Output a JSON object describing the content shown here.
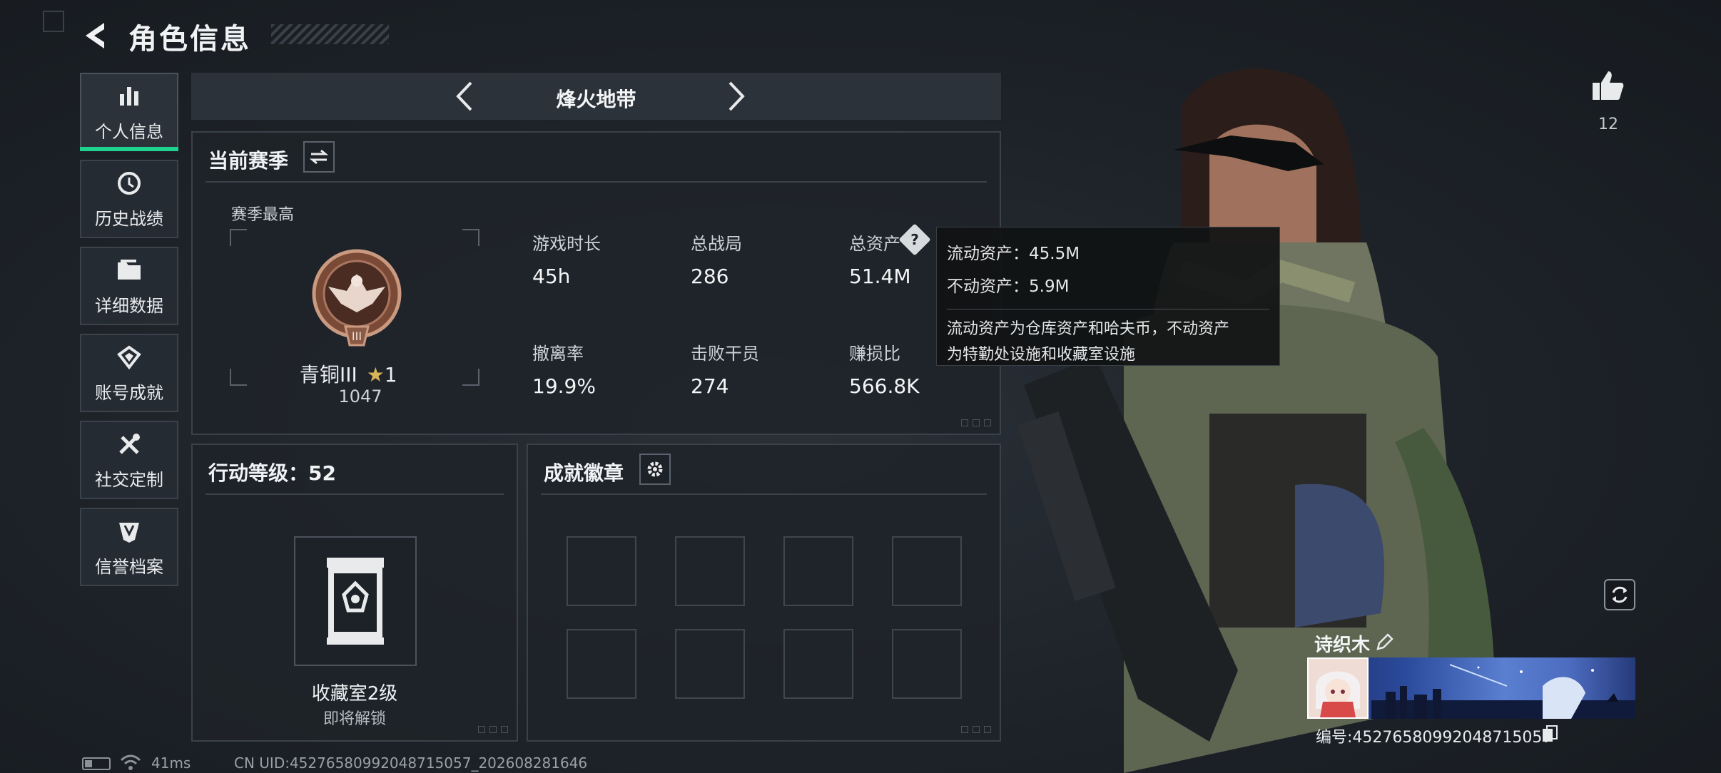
{
  "header": {
    "title": "角色信息"
  },
  "side_nav": [
    {
      "label": "个人信息",
      "icon": "bar-chart-icon",
      "active": true
    },
    {
      "label": "历史战绩",
      "icon": "history-clock-icon",
      "active": false
    },
    {
      "label": "详细数据",
      "icon": "folder-icon",
      "active": false
    },
    {
      "label": "账号成就",
      "icon": "achievement-icon",
      "active": false
    },
    {
      "label": "社交定制",
      "icon": "tools-icon",
      "active": false
    },
    {
      "label": "信誉档案",
      "icon": "credit-shield-icon",
      "active": false
    }
  ],
  "mode_bar": {
    "title": "烽火地带"
  },
  "season": {
    "heading": "当前赛季",
    "best_label": "赛季最高",
    "rank_name": "青铜III",
    "rank_stars": "1",
    "rank_score": "1047",
    "stats": [
      {
        "label": "游戏时长",
        "value": "45h"
      },
      {
        "label": "总战局",
        "value": "286"
      },
      {
        "label": "总资产",
        "value": "51.4M"
      },
      {
        "label": "撤离率",
        "value": "19.9%"
      },
      {
        "label": "击败干员",
        "value": "274"
      },
      {
        "label": "赚损比",
        "value": "566.8K"
      }
    ]
  },
  "tooltip": {
    "liquid": "流动资产：45.5M",
    "fixed": "不动资产：5.9M",
    "desc_line1": "流动资产为仓库资产和哈夫币，不动资产",
    "desc_line2": "为特勤处设施和收藏室设施"
  },
  "action_level": {
    "heading": "行动等级：52",
    "collection_name": "收藏室2级",
    "collection_status": "即将解锁"
  },
  "achievements": {
    "heading": "成就徽章"
  },
  "profile": {
    "likes": "12",
    "nickname": "诗织木",
    "player_id": "编号:4527658099204871505​7"
  },
  "footer": {
    "ping": "41ms",
    "uid": "CN UID:4527658099204871505​7_202608281646"
  },
  "colors": {
    "accent": "#1ed38f",
    "panel_border": "#3a4149",
    "bronze": "#8a5a44"
  }
}
